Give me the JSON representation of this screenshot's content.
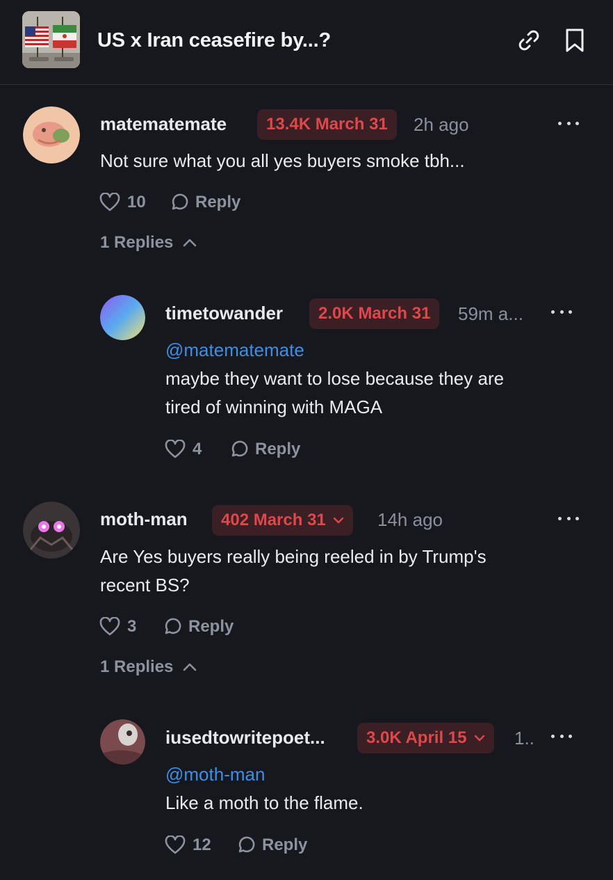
{
  "header": {
    "title": "US x Iran ceasefire by...?",
    "thumbnail": "us-iran-flags-image",
    "link_icon": "link-icon",
    "bookmark_icon": "bookmark-icon"
  },
  "colors": {
    "background": "#16181e",
    "pill_bg": "#3a1f24",
    "pill_text": "#e0474a",
    "mention": "#3c8fe8",
    "muted": "#8a909b"
  },
  "comments": [
    {
      "username": "matematemate",
      "position": "13.4K March 31",
      "time": "2h ago",
      "text": "Not sure what you all yes buyers smoke tbh...",
      "likes": "10",
      "reply_label": "Reply",
      "replies_toggle": "1 Replies",
      "replies": [
        {
          "username": "timetowander",
          "position": "2.0K March 31",
          "time": "59m a...",
          "mention": "@matematemate",
          "text_line1": "maybe they want to lose because they are",
          "text_line2": "tired of winning with MAGA",
          "likes": "4",
          "reply_label": "Reply"
        }
      ]
    },
    {
      "username": "moth-man",
      "position": "402 March 31",
      "time": "14h ago",
      "text_line1": "Are Yes buyers really being reeled in by Trump's",
      "text_line2": "recent BS?",
      "likes": "3",
      "reply_label": "Reply",
      "replies_toggle": "1 Replies",
      "replies": [
        {
          "username": "iusedtowritepoet...",
          "position": "3.0K April 15",
          "time": "1..",
          "mention": "@moth-man",
          "text": "Like a moth to the flame.",
          "likes": "12",
          "reply_label": "Reply"
        }
      ]
    }
  ]
}
